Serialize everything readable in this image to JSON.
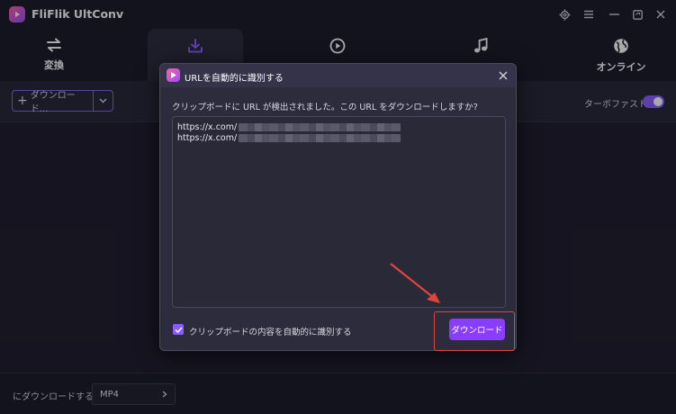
{
  "app": {
    "title": "FliFlik UltConv",
    "brand_colors": [
      "#ff5fa2",
      "#9b4dff"
    ],
    "accent": "#8a5cff"
  },
  "window_controls": [
    {
      "name": "settings",
      "icon": "gear-icon"
    },
    {
      "name": "menu",
      "icon": "hamburger-menu-icon"
    },
    {
      "name": "minimize",
      "icon": "minimize-icon"
    },
    {
      "name": "maximize",
      "icon": "maximize-icon"
    },
    {
      "name": "close",
      "icon": "close-icon"
    }
  ],
  "tabs": [
    {
      "label": "変換",
      "icon": "swap-arrows-icon",
      "active": false
    },
    {
      "label": "",
      "icon": "download-icon",
      "active": true
    },
    {
      "label": "",
      "icon": "play-circle-icon",
      "active": false
    },
    {
      "label": "",
      "icon": "music-note-icon",
      "active": false
    },
    {
      "label": "オンライン",
      "icon": "globe-icon",
      "active": false
    }
  ],
  "toolbar": {
    "download_label": "ダウンロード...",
    "turbo_label": "ターボファスト",
    "turbo_on": true
  },
  "footer": {
    "download_to_label": "にダウンロードする:",
    "format_value": "MP4"
  },
  "dialog": {
    "title": "URLを自動的に識別する",
    "message": "クリップボードに URL が検出されました。この URL をダウンロードしますか?",
    "urls": [
      "https://x.com/",
      "https://x.com/"
    ],
    "auto_detect_label": "クリップボードの内容を自動的に識別する",
    "auto_detect_checked": true,
    "download_button": "ダウンロード",
    "highlight_color": "#e0453c"
  }
}
